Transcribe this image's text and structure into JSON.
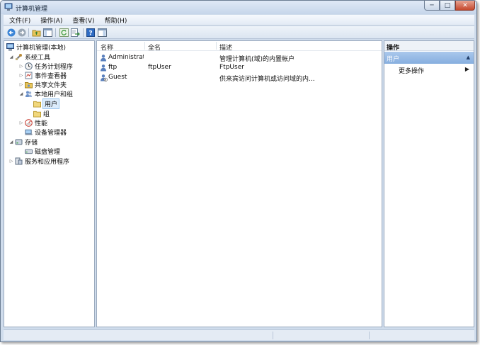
{
  "window": {
    "title": "计算机管理"
  },
  "controls": {
    "minimize": "─",
    "maximize": "□",
    "close": "✕"
  },
  "menu": [
    "文件(F)",
    "操作(A)",
    "查看(V)",
    "帮助(H)"
  ],
  "toolbar": {
    "buttons": [
      "back-arrow-icon",
      "forward-arrow-icon",
      "up-folder-icon",
      "show-hide-tree-icon",
      "refresh-icon",
      "export-icon",
      "help-icon",
      "properties-icon"
    ]
  },
  "tree": {
    "root": "计算机管理(本地)",
    "system_tools": "系统工具",
    "task_scheduler": "任务计划程序",
    "event_viewer": "事件查看器",
    "shared_folders": "共享文件夹",
    "local_users_groups": "本地用户和组",
    "users": "用户",
    "groups": "组",
    "performance": "性能",
    "device_manager": "设备管理器",
    "storage": "存储",
    "disk_management": "磁盘管理",
    "services_apps": "服务和应用程序"
  },
  "list": {
    "columns": {
      "name": "名称",
      "fullname": "全名",
      "description": "描述"
    },
    "rows": [
      {
        "name": "Administrat...",
        "fullname": "",
        "description": "管理计算机(域)的内置帐户"
      },
      {
        "name": "ftp",
        "fullname": "ftpUser",
        "description": "FtpUser"
      },
      {
        "name": "Guest",
        "fullname": "",
        "description": "供来宾访问计算机或访问域的内..."
      }
    ]
  },
  "actions": {
    "title": "操作",
    "section": "用户",
    "section_arrow": "▲",
    "more": "更多操作",
    "more_arrow": "▶"
  }
}
